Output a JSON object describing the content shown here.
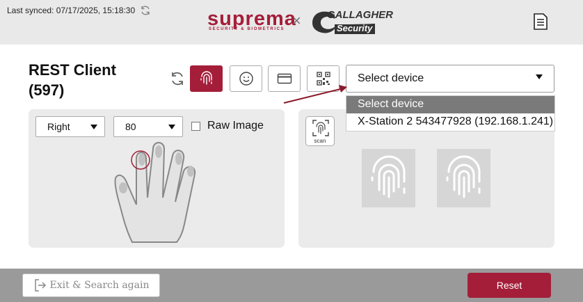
{
  "header": {
    "last_synced": "Last synced: 07/17/2025, 15:18:30",
    "brand_primary": "suprema",
    "brand_primary_sub": "SECURITY & BIOMETRICS",
    "brand_separator": "×",
    "brand_secondary": "GALLAGHER",
    "brand_secondary_sub": "Security",
    "icons": {
      "sync": "refresh-icon",
      "document": "document-icon"
    }
  },
  "main": {
    "title": "REST Client (597)",
    "modes": [
      {
        "name": "fingerprint",
        "icon": "fingerprint-icon",
        "active": true
      },
      {
        "name": "face",
        "icon": "face-icon",
        "active": false
      },
      {
        "name": "card",
        "icon": "card-icon",
        "active": false
      },
      {
        "name": "qr",
        "icon": "qr-icon",
        "active": false
      }
    ],
    "device_select": {
      "value": "Select device",
      "options": [
        "Select device",
        "X-Station 2 543477928 (192.168.1.241)"
      ]
    },
    "hand_select": "Right",
    "quality_select": "80",
    "raw_image_label": "Raw Image",
    "raw_image_checked": false,
    "scan_label": "scan"
  },
  "footer": {
    "exit_label": "Exit & Search again",
    "reset_label": "Reset"
  },
  "colors": {
    "accent": "#a41e3a",
    "panel": "#ebebeb",
    "footer": "#9a9a9a"
  }
}
